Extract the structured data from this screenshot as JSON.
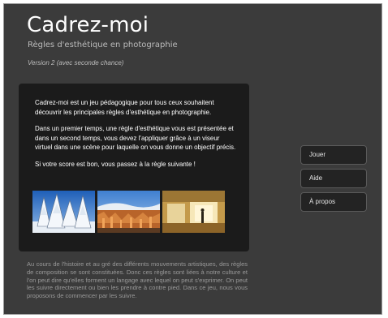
{
  "header": {
    "title": "Cadrez-moi",
    "subtitle": "Règles d'esthétique en photographie",
    "version": "Version 2 (avec seconde chance)"
  },
  "intro": {
    "paragraphs": [
      "Cadrez-moi est un jeu pédagogique pour tous ceux souhaitent découvrir les principales règles d'esthétique en photographie.",
      "Dans un premier temps, une règle d'esthétique vous est présentée et dans un second temps, vous devez l'appliquer grâce à un viseur virtuel dans une scène pour laquelle on vous donne un objectif précis.",
      "Si votre score est bon, vous passez à la règle suivante !"
    ]
  },
  "thumbnails": [
    {
      "icon": "snowy-forest-photo"
    },
    {
      "icon": "canyon-landscape-photo"
    },
    {
      "icon": "museum-interior-photo"
    }
  ],
  "history": "Au cours de l'histoire et au gré des différents mouvements artistiques, des règles de composition se sont constituées. Donc ces règles sont liées à notre culture et l'on peut dire qu'elles forment un langage avec lequel on peut s'exprimer. On peut les suivre directement ou bien les prendre à contre pied. Dans ce jeu, nous vous proposons de commencer par les suivre.",
  "menu": {
    "items": [
      {
        "label": "Jouer"
      },
      {
        "label": "Aide"
      },
      {
        "label": "À propos"
      }
    ]
  },
  "colors": {
    "background": "#3b3b3b",
    "panel": "#1b1b1b",
    "button": "#232323"
  }
}
